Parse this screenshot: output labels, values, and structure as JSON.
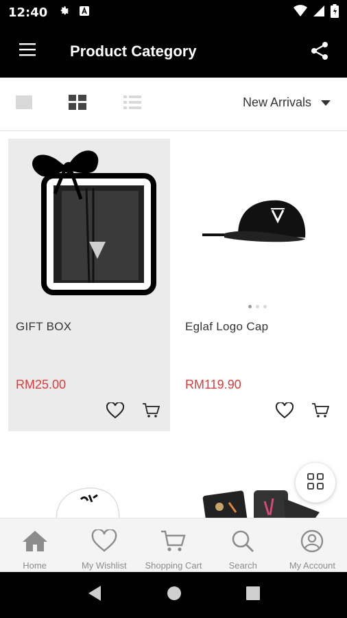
{
  "status_bar": {
    "time": "12:40",
    "icons": [
      "settings-icon",
      "a-box-icon",
      "wifi-icon",
      "signal-icon",
      "battery-icon"
    ]
  },
  "app_bar": {
    "title": "Product Category",
    "menu_icon": "hamburger-icon",
    "share_icon": "share-icon"
  },
  "toolbar": {
    "view_modes": [
      "single-view-icon",
      "grid-view-icon",
      "list-view-icon"
    ],
    "active_view": "grid",
    "sort": {
      "selected": "New Arrivals"
    }
  },
  "products": [
    {
      "name": "GIFT BOX",
      "price": "RM25.00",
      "image": "gift-box-image"
    },
    {
      "name": "Eglaf Logo Cap",
      "price": "RM119.90",
      "image": "logo-cap-image"
    }
  ],
  "colors": {
    "accent_price": "#e03a3a",
    "app_bar": "#000000"
  },
  "bottom_nav": [
    {
      "label": "Home",
      "icon": "home-icon"
    },
    {
      "label": "My Wishlist",
      "icon": "heart-icon"
    },
    {
      "label": "Shopping Cart",
      "icon": "cart-icon"
    },
    {
      "label": "Search",
      "icon": "search-icon"
    },
    {
      "label": "My Account",
      "icon": "account-icon"
    }
  ]
}
